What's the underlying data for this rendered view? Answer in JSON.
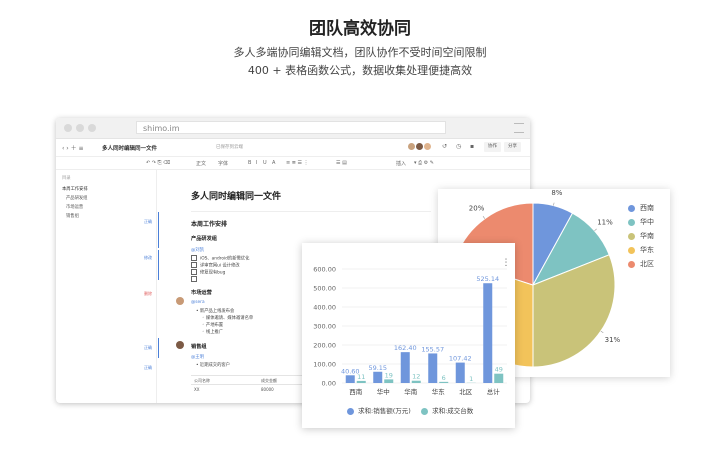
{
  "hero": {
    "title": "团队高效协同",
    "line1": "多人多端协同编辑文档，团队协作不受时间空间限制",
    "line2": "400 + 表格函数公式，数据收集处理便捷高效"
  },
  "browser": {
    "url": "shimo.im",
    "doc_title": "多人同时编辑同一文件",
    "status": "已保存到云端",
    "share_label": "协作",
    "more_label": "分享",
    "toolbar_items": [
      "正文",
      "字体",
      "B",
      "I",
      "U",
      "A",
      "插入"
    ],
    "sidebar": {
      "header": "目录",
      "items": [
        "本周工作安排",
        "产品研发组",
        "市场运营",
        "销售组"
      ]
    },
    "comments": [
      "正确",
      "修改",
      "删除",
      "正确",
      "正确"
    ],
    "doc": {
      "h1": "多人同时编辑同一文件",
      "section": "本周工作安排",
      "group1": "产品研发组",
      "group1_mention": "@刘凯",
      "group1_items": [
        "iOS、android的新需优化",
        "详审官网ui 设计修改",
        "修复现有bug",
        ""
      ],
      "group2": "市场运营",
      "group2_mention": "@sera",
      "group2_items": [
        "新产品上线发布会",
        "媒体邀请、媒体邀请名单",
        "产地布置",
        "线上推广"
      ],
      "group3": "销售组",
      "group3_mention": "@王明",
      "group3_items": [
        "近期成交的客户"
      ],
      "table_headers": [
        "公司名称",
        "成交金额"
      ],
      "table_row": [
        "XX",
        "80000"
      ]
    }
  },
  "chart_data": [
    {
      "type": "pie",
      "categories": [
        "西南",
        "华中",
        "华南",
        "华东",
        "北区"
      ],
      "values": [
        8,
        11,
        31,
        30,
        20
      ],
      "labels_shown": [
        "8%",
        "11%",
        "31%",
        "",
        "20%"
      ],
      "colors": [
        "#6f96dc",
        "#7ec3c2",
        "#c9c379",
        "#f2c35a",
        "#ec8a6e"
      ],
      "legend": "right"
    },
    {
      "type": "bar",
      "categories": [
        "西南",
        "华中",
        "华南",
        "华东",
        "北区",
        "总计"
      ],
      "series": [
        {
          "name": "求和:销售额(万元)",
          "values": [
            40.6,
            59.15,
            162.4,
            155.57,
            107.42,
            525.14
          ],
          "color": "#6f96dc"
        },
        {
          "name": "求和:成交台数",
          "values": [
            11,
            19,
            12,
            6,
            1,
            49
          ],
          "color": "#7ec3c2"
        }
      ],
      "value_labels": {
        "s0": [
          "40.60",
          "59.15",
          "162.40",
          "155.57",
          "107.42",
          "525.14"
        ],
        "s1": [
          "11",
          "19",
          "12",
          "6",
          "1",
          "49"
        ]
      },
      "yticks": [
        "600.00",
        "500.00",
        "400.00",
        "300.00",
        "200.00",
        "100.00",
        "0.00"
      ],
      "ylim": [
        0,
        600
      ],
      "grid": true,
      "legend": "bottom"
    }
  ]
}
